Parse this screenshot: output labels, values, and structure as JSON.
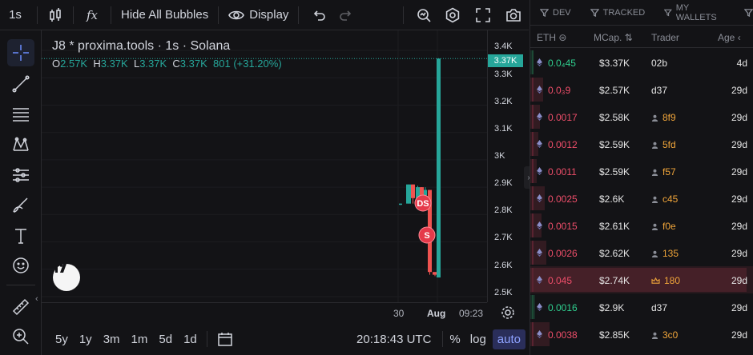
{
  "toolbar": {
    "interval": "1s",
    "fx_label": "fx",
    "hide_bubbles": "Hide All Bubbles",
    "display": "Display"
  },
  "chart": {
    "title": "J8 * proxima.tools · 1s · Solana",
    "ohlc": {
      "o_label": "O",
      "o_value": "2.57K",
      "h_label": "H",
      "h_value": "3.37K",
      "l_label": "L",
      "l_value": "3.37K",
      "c_label": "C",
      "c_value": "3.37K",
      "change": "801 (+31.20%)"
    },
    "markers": [
      "DS",
      "S"
    ],
    "current_price": "3.37K",
    "colors": {
      "up": "#26a69a",
      "down": "#ef5350",
      "marker": "#e5394a"
    }
  },
  "price_axis": [
    "3.4K",
    "3.3K",
    "3.2K",
    "3.1K",
    "3K",
    "2.9K",
    "2.8K",
    "2.7K",
    "2.6K",
    "2.5K"
  ],
  "time_axis": [
    "30",
    "Aug",
    "09:23"
  ],
  "bottom": {
    "ranges": [
      "5y",
      "1y",
      "3m",
      "1m",
      "5d",
      "1d"
    ],
    "clock": "20:18:43 UTC",
    "percent": "%",
    "log": "log",
    "auto": "auto"
  },
  "chart_data": {
    "type": "candlestick",
    "title": "J8 * proxima.tools · 1s · Solana",
    "x_ticks": [
      "30",
      "Aug",
      "09:23"
    ],
    "y_ticks": [
      "2.5K",
      "2.6K",
      "2.7K",
      "2.8K",
      "2.9K",
      "3K",
      "3.1K",
      "3.2K",
      "3.3K",
      "3.4K"
    ],
    "ylim": [
      2500,
      3400
    ],
    "candles": [
      {
        "o": 2840,
        "h": 2840,
        "l": 2835,
        "c": 2840
      },
      {
        "o": 2840,
        "h": 2910,
        "l": 2840,
        "c": 2910
      },
      {
        "o": 2910,
        "h": 2910,
        "l": 2840,
        "c": 2860
      },
      {
        "o": 2860,
        "h": 2905,
        "l": 2860,
        "c": 2900
      },
      {
        "o": 2900,
        "h": 2900,
        "l": 2860,
        "c": 2870
      },
      {
        "o": 2870,
        "h": 2900,
        "l": 2860,
        "c": 2890
      },
      {
        "o": 2890,
        "h": 2890,
        "l": 2580,
        "c": 2590
      },
      {
        "o": 2590,
        "h": 2590,
        "l": 2575,
        "c": 2580
      },
      {
        "o": 2570,
        "h": 3370,
        "l": 2570,
        "c": 3370
      }
    ],
    "last_price": 3370,
    "grid": true
  },
  "panel": {
    "tabs": [
      "DEV",
      "TRACKED",
      "MY WALLETS"
    ],
    "headers": {
      "eth": "ETH",
      "mcap": "MCap.",
      "trader": "Trader",
      "age": "Age"
    },
    "rows": [
      {
        "amount": "0.0₄45",
        "mcap": "$3.37K",
        "trader": "02b",
        "age": "4d",
        "side": "buy",
        "tag": "none"
      },
      {
        "amount": "0.0₃9",
        "mcap": "$2.57K",
        "trader": "d37",
        "age": "29d",
        "side": "sell",
        "tag": "none"
      },
      {
        "amount": "0.0017",
        "mcap": "$2.58K",
        "trader": "8f9",
        "age": "29d",
        "side": "sell",
        "tag": "person"
      },
      {
        "amount": "0.0012",
        "mcap": "$2.59K",
        "trader": "5fd",
        "age": "29d",
        "side": "sell",
        "tag": "person"
      },
      {
        "amount": "0.0011",
        "mcap": "$2.59K",
        "trader": "f57",
        "age": "29d",
        "side": "sell",
        "tag": "person"
      },
      {
        "amount": "0.0025",
        "mcap": "$2.6K",
        "trader": "c45",
        "age": "29d",
        "side": "sell",
        "tag": "person"
      },
      {
        "amount": "0.0015",
        "mcap": "$2.61K",
        "trader": "f0e",
        "age": "29d",
        "side": "sell",
        "tag": "person"
      },
      {
        "amount": "0.0026",
        "mcap": "$2.62K",
        "trader": "135",
        "age": "29d",
        "side": "sell",
        "tag": "person"
      },
      {
        "amount": "0.045",
        "mcap": "$2.74K",
        "trader": "180",
        "age": "29d",
        "side": "sell",
        "tag": "crown"
      },
      {
        "amount": "0.0016",
        "mcap": "$2.9K",
        "trader": "d37",
        "age": "29d",
        "side": "buy",
        "tag": "none"
      },
      {
        "amount": "0.0038",
        "mcap": "$2.85K",
        "trader": "3c0",
        "age": "29d",
        "side": "sell",
        "tag": "person"
      }
    ]
  }
}
